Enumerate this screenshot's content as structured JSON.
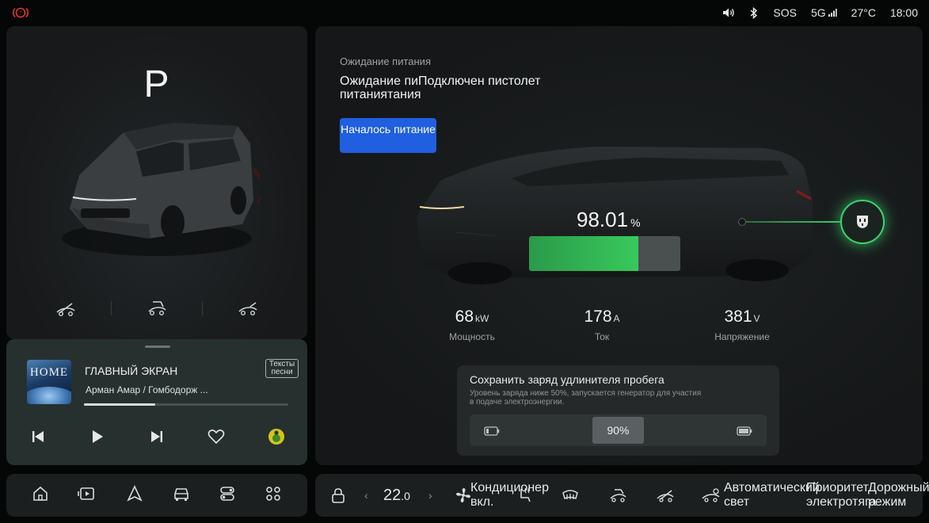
{
  "status_bar": {
    "alert_icon": "brake-warning-icon",
    "volume_icon": "speaker-icon",
    "bluetooth_icon": "bluetooth-icon",
    "sos": "SOS",
    "network": "5G",
    "temperature": "27°C",
    "time": "18:00",
    "alert_color": "#e03a2f"
  },
  "vehicle": {
    "gear": "P",
    "door_icons": [
      "left-door-icon",
      "tailgate-icon",
      "right-door-icon"
    ]
  },
  "music": {
    "album_text": "HOME",
    "title": "ГЛАВНЫЙ ЭКРАН",
    "artist": "Арман Амар / Гомбодорж ...",
    "lyrics_button": "Тексты песни",
    "progress": 0.35,
    "controls": [
      "previous-icon",
      "play-icon",
      "next-icon",
      "heart-icon",
      "music-app-icon"
    ]
  },
  "charging": {
    "subtitle": "Ожидание питания",
    "title": "Ожидание пиПодключен пистолет питаниятания",
    "start_button": "Началось питание",
    "soc_value": "98.01",
    "soc_unit": "%",
    "soc_fraction": 0.72,
    "accent_color": "#38c95c",
    "metrics": [
      {
        "value": "68",
        "unit": "kW",
        "label": "Мощность"
      },
      {
        "value": "178",
        "unit": "A",
        "label": "Ток"
      },
      {
        "value": "381",
        "unit": "V",
        "label": "Напряжение"
      }
    ]
  },
  "range_extender": {
    "title": "Сохранить заряд удлинителя пробега",
    "description": "Уровень заряда ниже 50%, запускается генератор для участия в подаче электроэнергии.",
    "value": "90%",
    "low_icon": "battery-low-icon",
    "high_icon": "battery-full-icon"
  },
  "dock_left": {
    "items": [
      "home-icon",
      "media-icon",
      "navigation-icon",
      "car-icon",
      "controls-icon",
      "apps-icon"
    ]
  },
  "dock_right": {
    "lock_icon": "lock-icon",
    "temp_whole": "22",
    "temp_decimal": ".0",
    "ac_label": "Кондиционер вкл.",
    "auto_light": "Автоматический свет",
    "ev_priority": "Приоритет электротяга",
    "drive_mode": "Дорожный режим"
  }
}
